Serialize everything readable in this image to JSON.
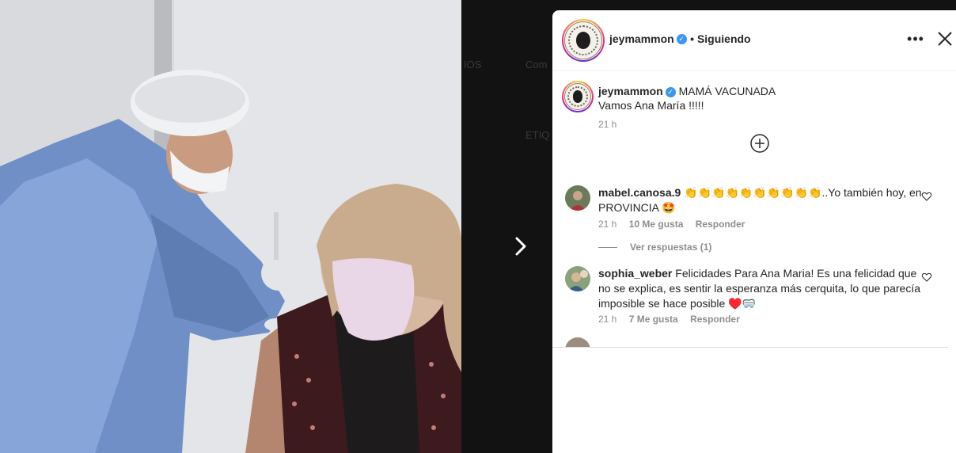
{
  "background": {
    "ghost_texts": [
      "IOS",
      "Com",
      "ETIQ"
    ]
  },
  "photo": {
    "description_icon": "vaccination-photo"
  },
  "post": {
    "username": "jeymammon",
    "following_label": "• Siguiendo",
    "caption_title": "MAMÁ VACUNADA",
    "caption_body": "Vamos Ana María !!!!!",
    "caption_time": "21 h"
  },
  "comments": [
    {
      "username": "mabel.canosa.9",
      "text": "👏👏👏👏👏👏👏👏👏👏..Yo también hoy, en PROVINCIA 🤩",
      "time": "21 h",
      "likes": "10 Me gusta",
      "reply": "Responder",
      "view_replies": "Ver respuestas (1)"
    },
    {
      "username": "sophia_weber",
      "text": "Felicidades Para Ana Maria! Es una felicidad que no se explica, es sentir la esperanza más cerquita, lo que parecía imposible se hace posible ♥️🥽",
      "time": "21 h",
      "likes": "7 Me gusta",
      "reply": "Responder"
    }
  ],
  "colors": {
    "verified": "#3897f0",
    "text": "#262626",
    "muted": "#8e8e8e"
  }
}
